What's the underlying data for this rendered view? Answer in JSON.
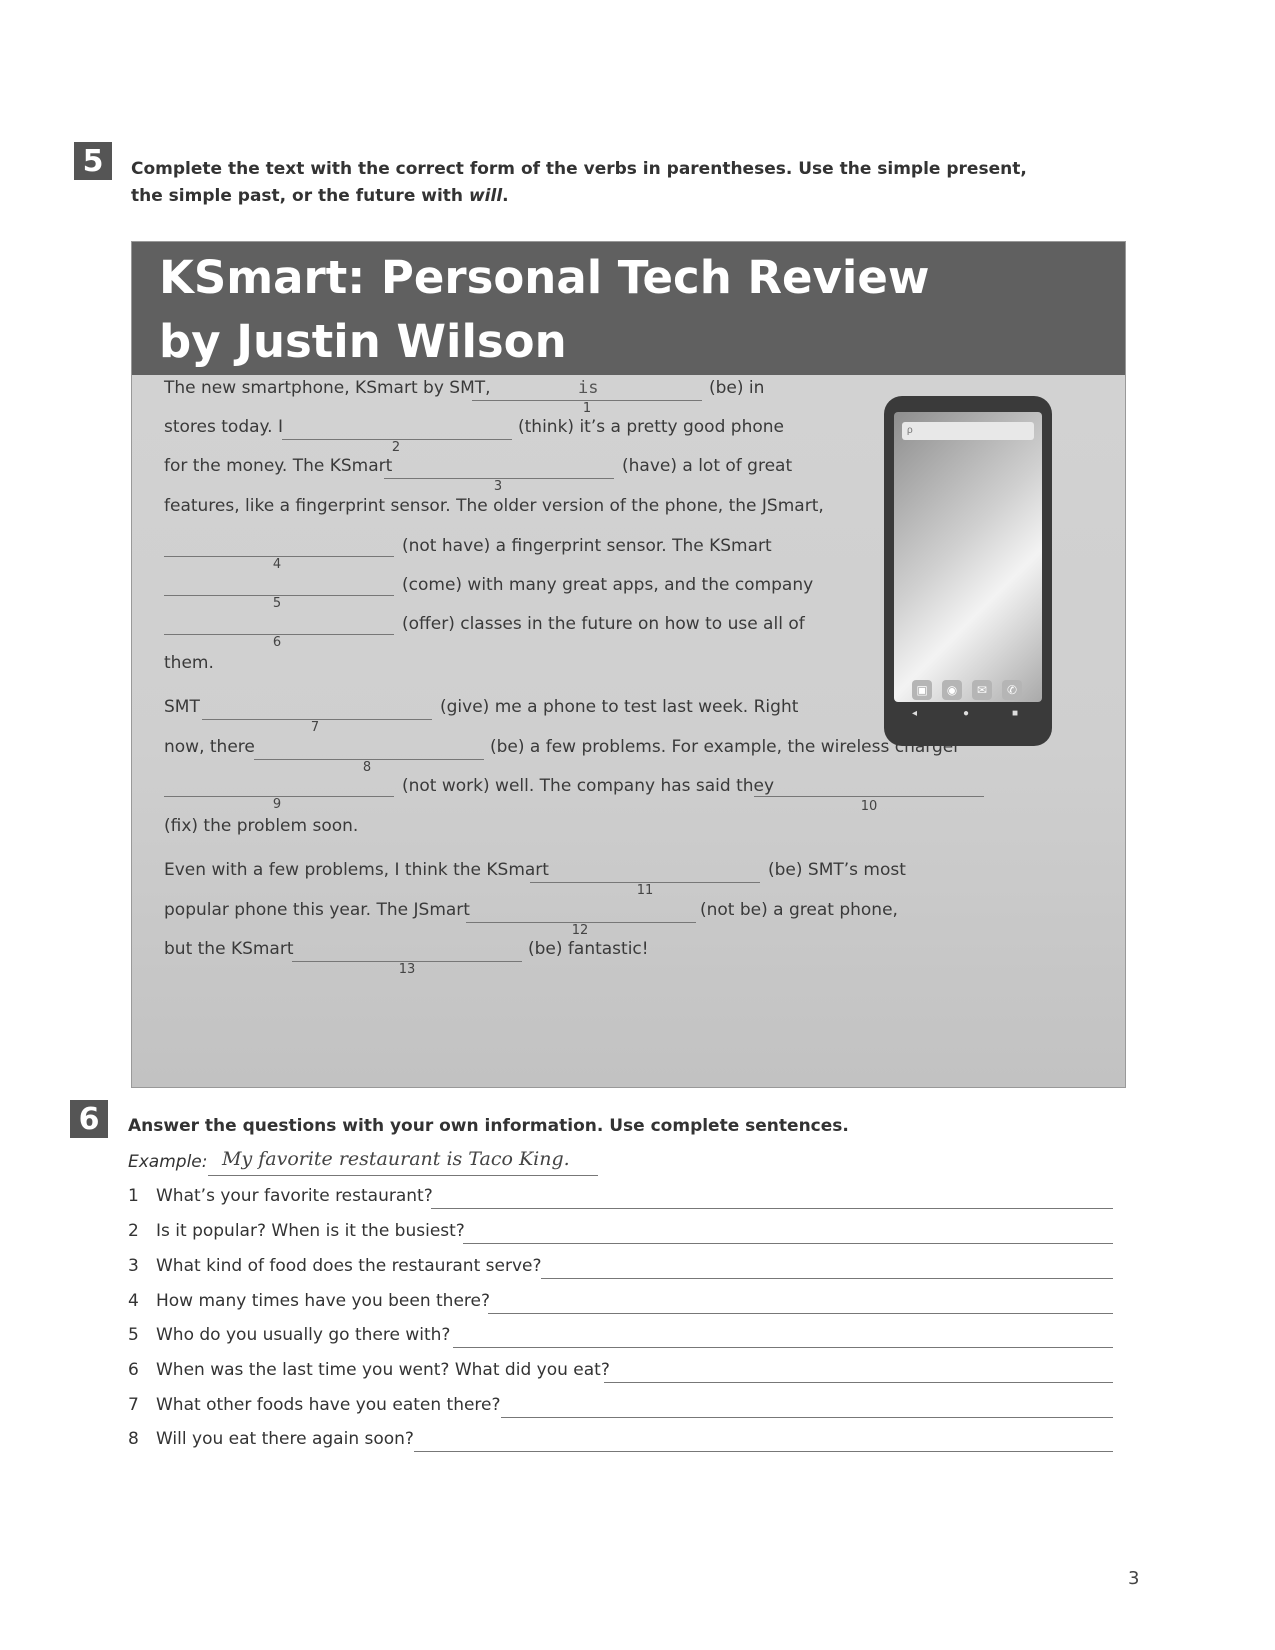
{
  "ex5": {
    "badge": "5",
    "instr_line1": "Complete the text with the correct form of the verbs in parentheses. Use the simple present,",
    "instr_line2_pre": "the simple past, or the future with ",
    "instr_line2_em": "will",
    "instr_line2_post": "."
  },
  "article": {
    "title_line1": "KSmart: Personal Tech Review",
    "title_line2": "by Justin Wilson",
    "t1a": "The new smartphone, KSmart by SMT,",
    "ans1": "is",
    "t1b": "(be) in",
    "t2a": "stores today. I",
    "t2b": "(think) it’s a pretty good phone",
    "t3a": "for the money. The KSmart",
    "t3b": "(have) a lot of great",
    "t4": "features, like a fingerprint sensor. The older version of the phone, the JSmart,",
    "t5": "(not have) a fingerprint sensor. The KSmart",
    "t6": "(come) with many great apps, and the company",
    "t7": "(offer) classes in the future on how to use all of",
    "t8": "them.",
    "t9a": "SMT",
    "t9b": "(give) me a phone to test last week. Right",
    "t10a": "now, there",
    "t10b": "(be) a few problems. For example, the wireless charger",
    "t11a": "(not work) well. The company has said they",
    "t12": "(fix) the problem soon.",
    "t13a": "Even with a few problems, I think the KSmart",
    "t13b": "(be) SMT’s most",
    "t14a": "popular phone this year. The JSmart",
    "t14b": "(not be) a great phone,",
    "t15a": "but the KSmart",
    "t15b": "(be) fantastic!",
    "nums": [
      "1",
      "2",
      "3",
      "4",
      "5",
      "6",
      "7",
      "8",
      "9",
      "10",
      "11",
      "12",
      "13"
    ],
    "phone_search": "ρ",
    "nav": [
      "◂",
      "●",
      "■"
    ]
  },
  "ex6": {
    "badge": "6",
    "instr": "Answer the questions with your own information. Use complete sentences.",
    "example_label": "Example:",
    "example_answer": "My favorite restaurant is Taco King.",
    "questions": [
      {
        "n": "1",
        "text": "What’s your favorite restaurant?"
      },
      {
        "n": "2",
        "text": "Is it popular? When is it the busiest?"
      },
      {
        "n": "3",
        "text": "What kind of food does the restaurant serve?"
      },
      {
        "n": "4",
        "text": "How many times have you been there?"
      },
      {
        "n": "5",
        "text": "Who do you usually go there with?"
      },
      {
        "n": "6",
        "text": "When was the last time you went? What did you eat?"
      },
      {
        "n": "7",
        "text": "What other foods have you eaten there?"
      },
      {
        "n": "8",
        "text": "Will you eat there again soon?"
      }
    ]
  },
  "page_number": "3"
}
